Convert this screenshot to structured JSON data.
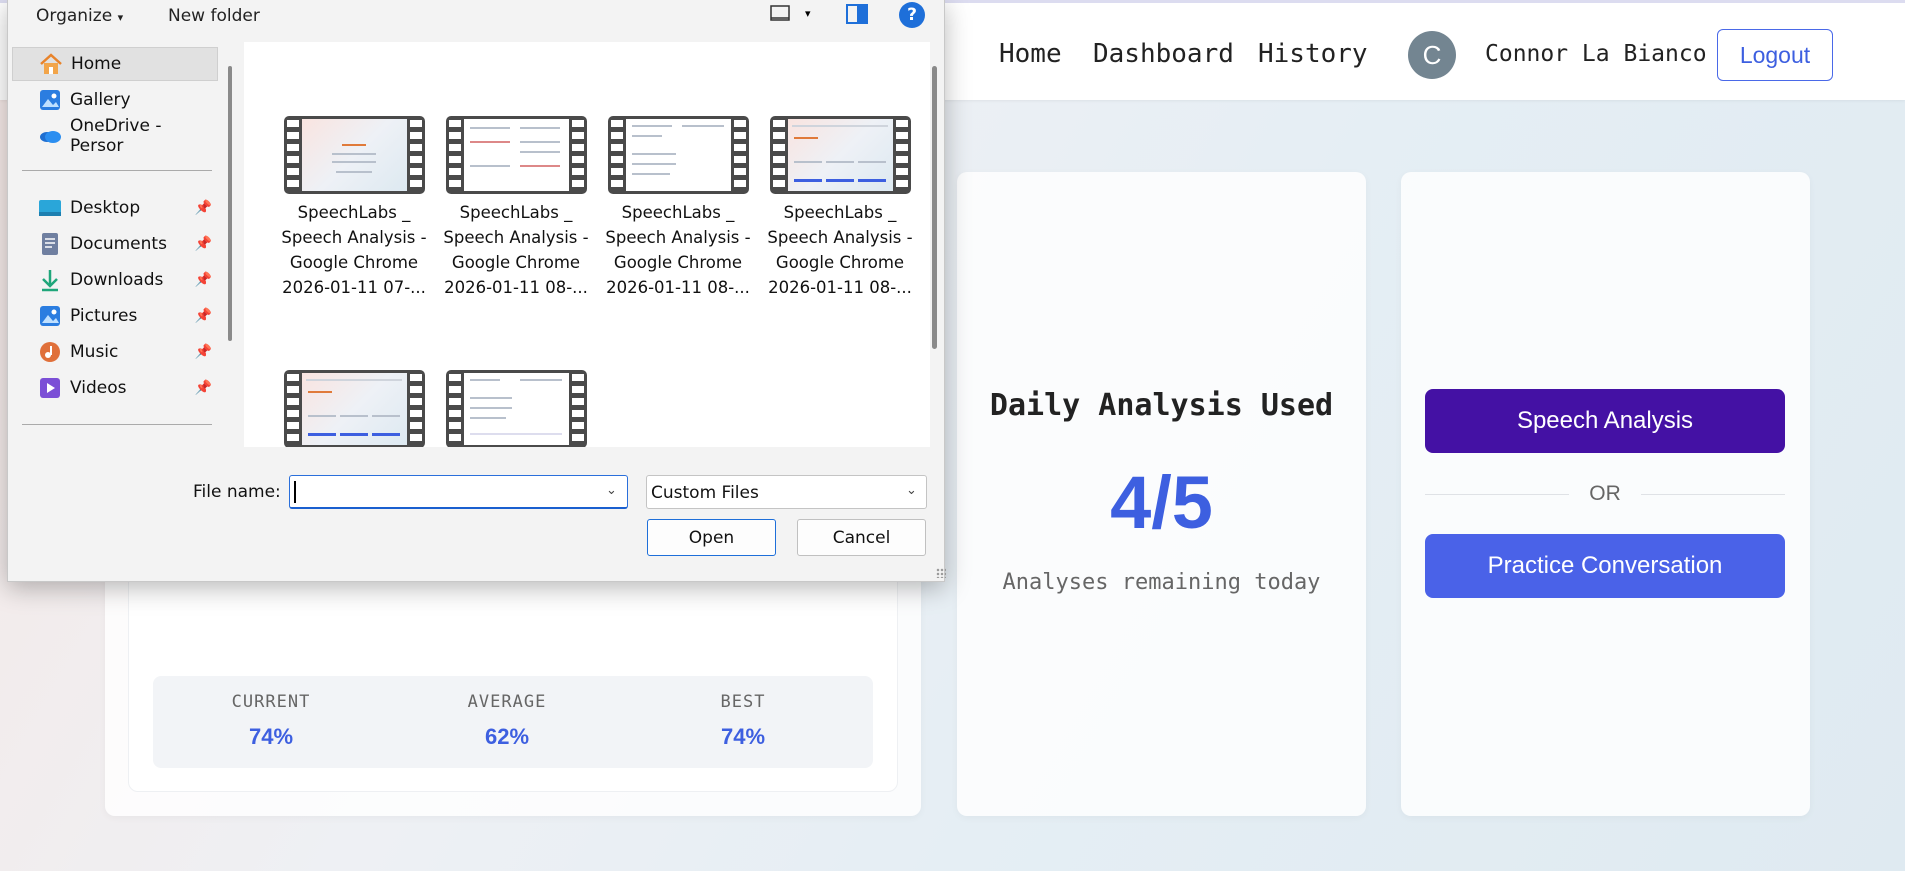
{
  "nav": {
    "links": [
      "Home",
      "Dashboard",
      "History"
    ],
    "avatar_initial": "C",
    "user_name": "Connor La Bianco",
    "logout_label": "Logout"
  },
  "stats": {
    "current_label": "CURRENT",
    "current_value": "74%",
    "average_label": "AVERAGE",
    "average_value": "62%",
    "best_label": "BEST",
    "best_value": "74%"
  },
  "daily": {
    "title": "Daily Analysis Used",
    "count": "4/5",
    "subtitle": "Analyses remaining today"
  },
  "actions": {
    "speech_label": "Speech Analysis",
    "or_label": "OR",
    "practice_label": "Practice Conversation",
    "speech_color": "#4411a4",
    "practice_color": "#4a62e8"
  },
  "dialog": {
    "organize_label": "Organize",
    "new_folder_label": "New folder",
    "help_label": "?",
    "nav_items": [
      {
        "label": "Home",
        "icon": "home-icon",
        "pinned": false
      },
      {
        "label": "Gallery",
        "icon": "gallery-icon",
        "pinned": false
      },
      {
        "label": "OneDrive - Persor",
        "icon": "onedrive-icon",
        "pinned": false
      },
      {
        "label": "Desktop",
        "icon": "desktop-icon",
        "pinned": true
      },
      {
        "label": "Documents",
        "icon": "documents-icon",
        "pinned": true
      },
      {
        "label": "Downloads",
        "icon": "downloads-icon",
        "pinned": true
      },
      {
        "label": "Pictures",
        "icon": "pictures-icon",
        "pinned": true
      },
      {
        "label": "Music",
        "icon": "music-icon",
        "pinned": true
      },
      {
        "label": "Videos",
        "icon": "videos-icon",
        "pinned": true
      }
    ],
    "files": [
      {
        "line1": "SpeechLabs _",
        "line2": "Speech Analysis -",
        "line3": "Google Chrome",
        "line4": "2026-01-11 07-..."
      },
      {
        "line1": "SpeechLabs _",
        "line2": "Speech Analysis -",
        "line3": "Google Chrome",
        "line4": "2026-01-11 08-..."
      },
      {
        "line1": "SpeechLabs _",
        "line2": "Speech Analysis -",
        "line3": "Google Chrome",
        "line4": "2026-01-11 08-..."
      },
      {
        "line1": "SpeechLabs _",
        "line2": "Speech Analysis -",
        "line3": "Google Chrome",
        "line4": "2026-01-11 08-..."
      }
    ],
    "file_name_label": "File name:",
    "file_name_value": "",
    "file_type": "Custom Files",
    "open_label": "Open",
    "cancel_label": "Cancel"
  }
}
